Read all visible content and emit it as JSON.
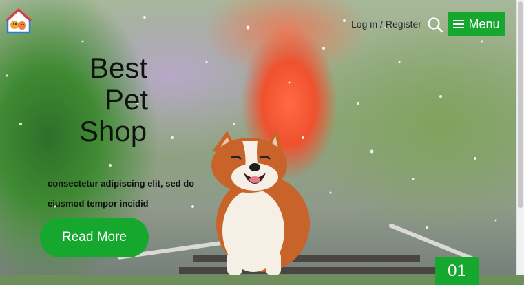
{
  "header": {
    "login_label": "Log in",
    "separator": "/",
    "register_label": "Register",
    "menu_label": "Menu",
    "menu_icon": "hamburger-icon",
    "search_icon": "search-icon",
    "logo_icon": "pet-house-logo"
  },
  "hero": {
    "title_line1": "Best",
    "title_line2": "Pet",
    "title_line3": "Shop",
    "subtitle": "consectetur adipiscing elit, sed do eiusmod tempor incidid",
    "cta_label": "Read More",
    "slide_number": "01"
  },
  "colors": {
    "accent": "#16a72e",
    "text": "#111111"
  }
}
